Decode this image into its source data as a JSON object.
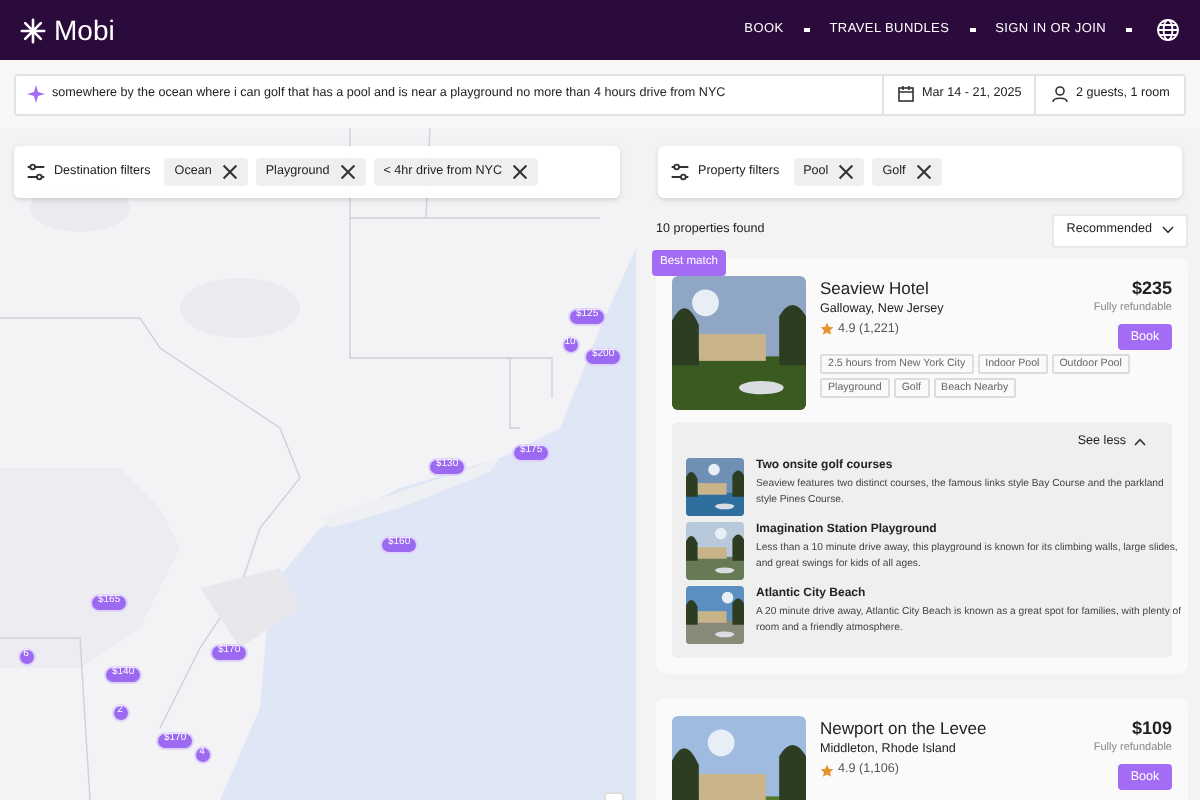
{
  "header": {
    "logo": "Mobi",
    "nav": [
      "BOOK",
      "TRAVEL BUNDLES",
      "SIGN IN OR JOIN"
    ]
  },
  "search": {
    "query": "somewhere by the ocean where i can golf that has a pool and is near a playground no more than 4 hours drive from NYC",
    "dates": "Mar 14 - 21, 2025",
    "guests": "2 guests, 1 room"
  },
  "destination_filters": {
    "label": "Destination filters",
    "chips": [
      "Ocean",
      "Playground",
      "< 4hr drive from NYC"
    ]
  },
  "property_filters": {
    "label": "Property filters",
    "chips": [
      "Pool",
      "Golf"
    ]
  },
  "map": {
    "kind": "picture",
    "pins": [
      "$125",
      "10",
      "$200",
      "$175",
      "$130",
      "$160",
      "$165",
      "6",
      "$140",
      "$170",
      "2",
      "$170",
      "4"
    ]
  },
  "results": {
    "count": "10 properties found",
    "sort": "Recommended"
  },
  "hotels": [
    {
      "badge": "Best match",
      "name": "Seaview Hotel",
      "location": "Galloway, New Jersey",
      "rating": "4.9 (1,221)",
      "price": "$235",
      "refund": "Fully refundable",
      "book": "Book",
      "tags": [
        "2.5 hours from New York City",
        "Indoor Pool",
        "Outdoor Pool",
        "Playground",
        "Golf",
        "Beach Nearby"
      ],
      "expanded": true,
      "toggle": "See less",
      "highlights": [
        {
          "title": "Two onsite golf courses",
          "text": "Seaview features two distinct courses, the famous links style Bay Course and the parkland style Pines Course."
        },
        {
          "title": "Imagination Station Playground",
          "text": "Less than a 10 minute drive away, this playground is known for its climbing walls, large slides, and great swings for kids of all ages."
        },
        {
          "title": "Atlantic City Beach",
          "text": "A 20 minute drive away, Atlantic City Beach is known as a great spot for families, with plenty of room and a friendly atmosphere."
        }
      ]
    },
    {
      "name": "Newport on the Levee",
      "location": "Middleton, Rhode Island",
      "rating": "4.9 (1,106)",
      "price": "$109",
      "refund": "Fully refundable",
      "book": "Book"
    }
  ]
}
